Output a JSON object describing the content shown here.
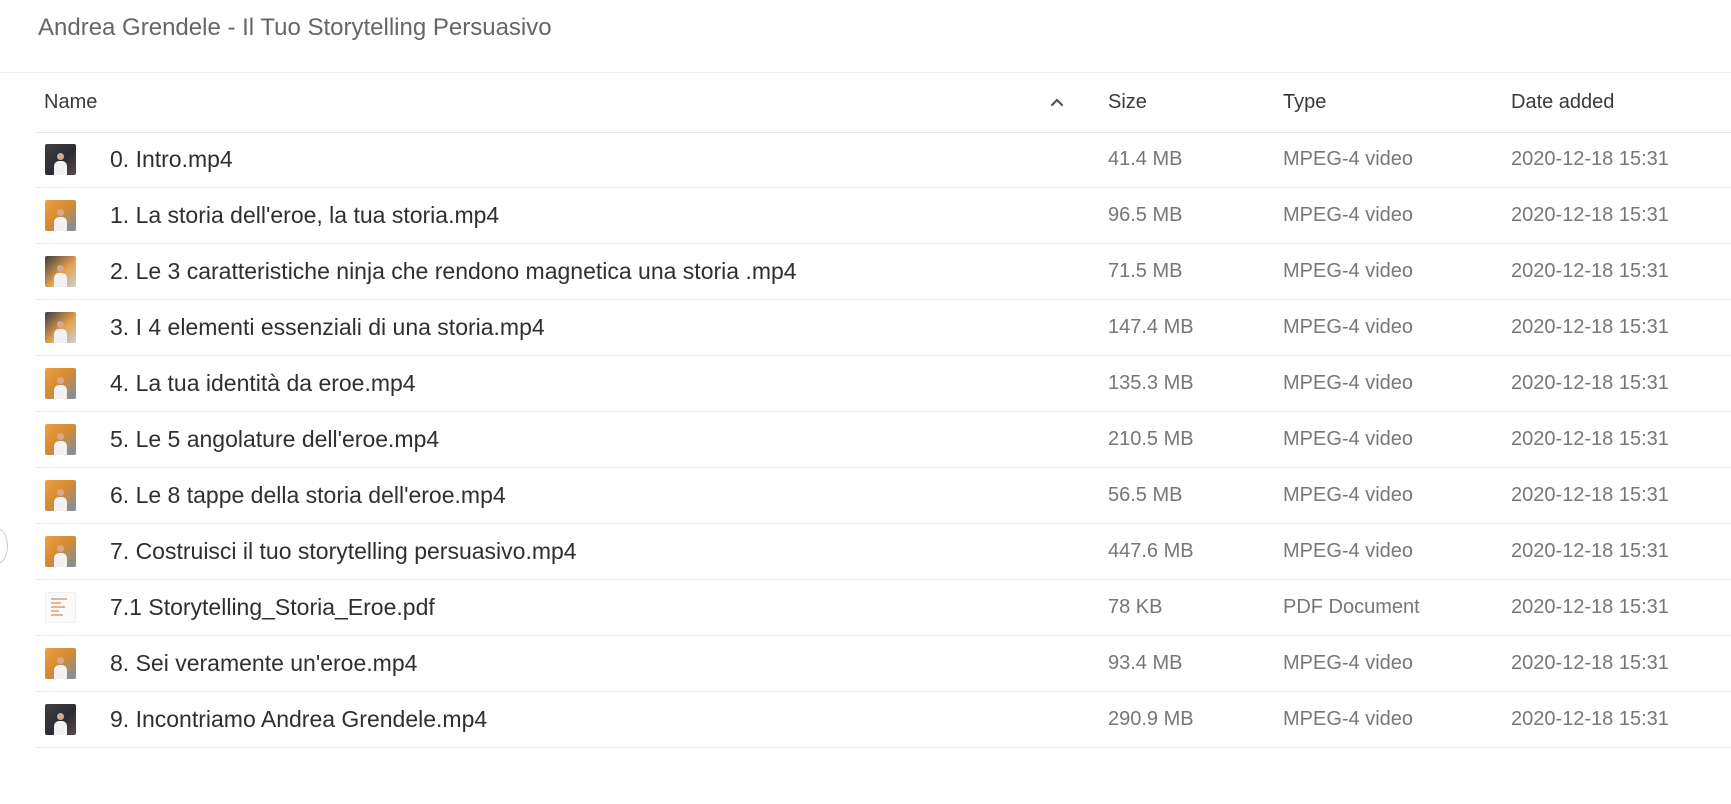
{
  "page": {
    "title": "Andrea Grendele - Il Tuo Storytelling Persuasivo"
  },
  "columns": {
    "name": "Name",
    "size": "Size",
    "type": "Type",
    "date": "Date added"
  },
  "sort": {
    "column": "Name",
    "direction": "ascending"
  },
  "files": [
    {
      "name": "0. Intro.mp4",
      "size": "41.4 MB",
      "type": "MPEG-4 video",
      "date": "2020-12-18 15:31",
      "thumb": "dark"
    },
    {
      "name": "1. La storia dell'eroe, la tua storia.mp4",
      "size": "96.5 MB",
      "type": "MPEG-4 video",
      "date": "2020-12-18 15:31",
      "thumb": "orange"
    },
    {
      "name": "2. Le 3 caratteristiche ninja che rendono magnetica una storia .mp4",
      "size": "71.5 MB",
      "type": "MPEG-4 video",
      "date": "2020-12-18 15:31",
      "thumb": "mix"
    },
    {
      "name": "3. I 4 elementi essenziali di una storia.mp4",
      "size": "147.4 MB",
      "type": "MPEG-4 video",
      "date": "2020-12-18 15:31",
      "thumb": "mix"
    },
    {
      "name": "4. La tua identità da eroe.mp4",
      "size": "135.3 MB",
      "type": "MPEG-4 video",
      "date": "2020-12-18 15:31",
      "thumb": "orange"
    },
    {
      "name": "5. Le 5 angolature dell'eroe.mp4",
      "size": "210.5 MB",
      "type": "MPEG-4 video",
      "date": "2020-12-18 15:31",
      "thumb": "orange"
    },
    {
      "name": "6. Le 8 tappe della storia dell'eroe.mp4",
      "size": "56.5 MB",
      "type": "MPEG-4 video",
      "date": "2020-12-18 15:31",
      "thumb": "orange"
    },
    {
      "name": "7. Costruisci il tuo storytelling persuasivo.mp4",
      "size": "447.6 MB",
      "type": "MPEG-4 video",
      "date": "2020-12-18 15:31",
      "thumb": "orange"
    },
    {
      "name": "7.1 Storytelling_Storia_Eroe.pdf",
      "size": "78 KB",
      "type": "PDF Document",
      "date": "2020-12-18 15:31",
      "thumb": "pdf"
    },
    {
      "name": "8. Sei veramente un'eroe.mp4",
      "size": "93.4 MB",
      "type": "MPEG-4 video",
      "date": "2020-12-18 15:31",
      "thumb": "orange"
    },
    {
      "name": "9. Incontriamo Andrea Grendele.mp4",
      "size": "290.9 MB",
      "type": "MPEG-4 video",
      "date": "2020-12-18 15:31",
      "thumb": "dark"
    }
  ],
  "icons": {
    "sort": "chevron-up-icon",
    "video_thumbnail": "video-thumbnail",
    "pdf_thumbnail": "pdf-thumbnail"
  }
}
